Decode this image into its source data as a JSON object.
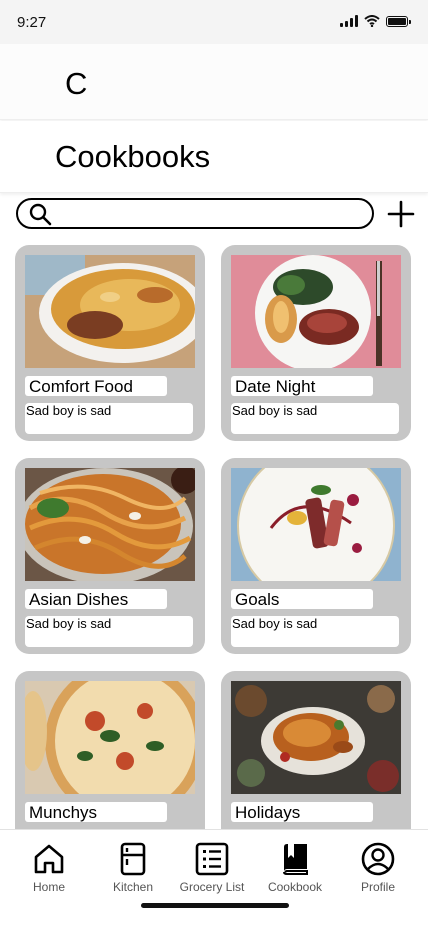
{
  "status_bar": {
    "time": "9:27"
  },
  "header": {
    "logo": "C"
  },
  "page": {
    "title": "Cookbooks"
  },
  "search": {
    "value": "",
    "placeholder": ""
  },
  "add_button": {
    "icon": "plus-icon"
  },
  "cookbooks": [
    {
      "title": "Comfort Food",
      "description": "Sad boy is sad",
      "image": "shepherds-pie-photo"
    },
    {
      "title": "Date Night",
      "description": "Sad boy is sad",
      "image": "steak-dinner-photo"
    },
    {
      "title": "Asian Dishes",
      "description": "Sad boy is sad",
      "image": "noodles-photo"
    },
    {
      "title": "Goals",
      "description": "Sad boy is sad",
      "image": "plated-duck-photo"
    },
    {
      "title": "Munchys",
      "description": "",
      "image": "pizza-photo"
    },
    {
      "title": "Holidays",
      "description": "",
      "image": "roast-turkey-photo"
    }
  ],
  "bottom_nav": [
    {
      "label": "Home",
      "icon": "home-icon"
    },
    {
      "label": "Kitchen",
      "icon": "kitchen-icon"
    },
    {
      "label": "Grocery List",
      "icon": "list-icon"
    },
    {
      "label": "Cookbook",
      "icon": "book-icon"
    },
    {
      "label": "Profile",
      "icon": "profile-icon"
    }
  ],
  "colors": {
    "card_bg": "#c6c6c6",
    "text": "#000000",
    "nav_label": "#555555"
  }
}
